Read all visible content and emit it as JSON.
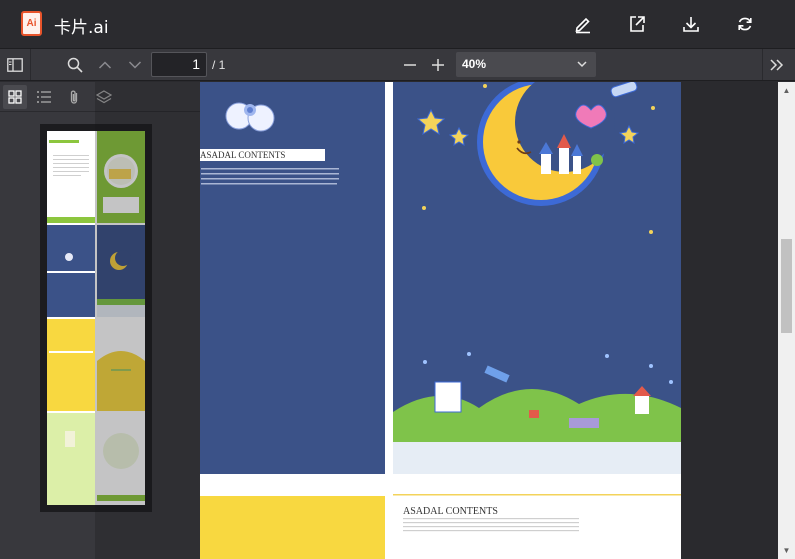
{
  "app": {
    "file_badge": "Ai",
    "title": "卡片.ai"
  },
  "titlebar": {
    "actions": [
      {
        "name": "edit-button",
        "icon": "pen-icon"
      },
      {
        "name": "share-button",
        "icon": "share-icon"
      },
      {
        "name": "download-button",
        "icon": "download-icon"
      },
      {
        "name": "refresh-button",
        "icon": "refresh-icon"
      }
    ]
  },
  "toolbar": {
    "page_value": "1",
    "page_total": "/ 1",
    "zoom_value": "40%"
  },
  "document": {
    "left_heading": "ASADAL CONTENTS",
    "bottom_heading": "ASADAL CONTENTS"
  },
  "colors": {
    "accent": "#e8542b",
    "navy": "#3b5288",
    "yellow": "#f8d840",
    "green": "#8cc63e"
  }
}
